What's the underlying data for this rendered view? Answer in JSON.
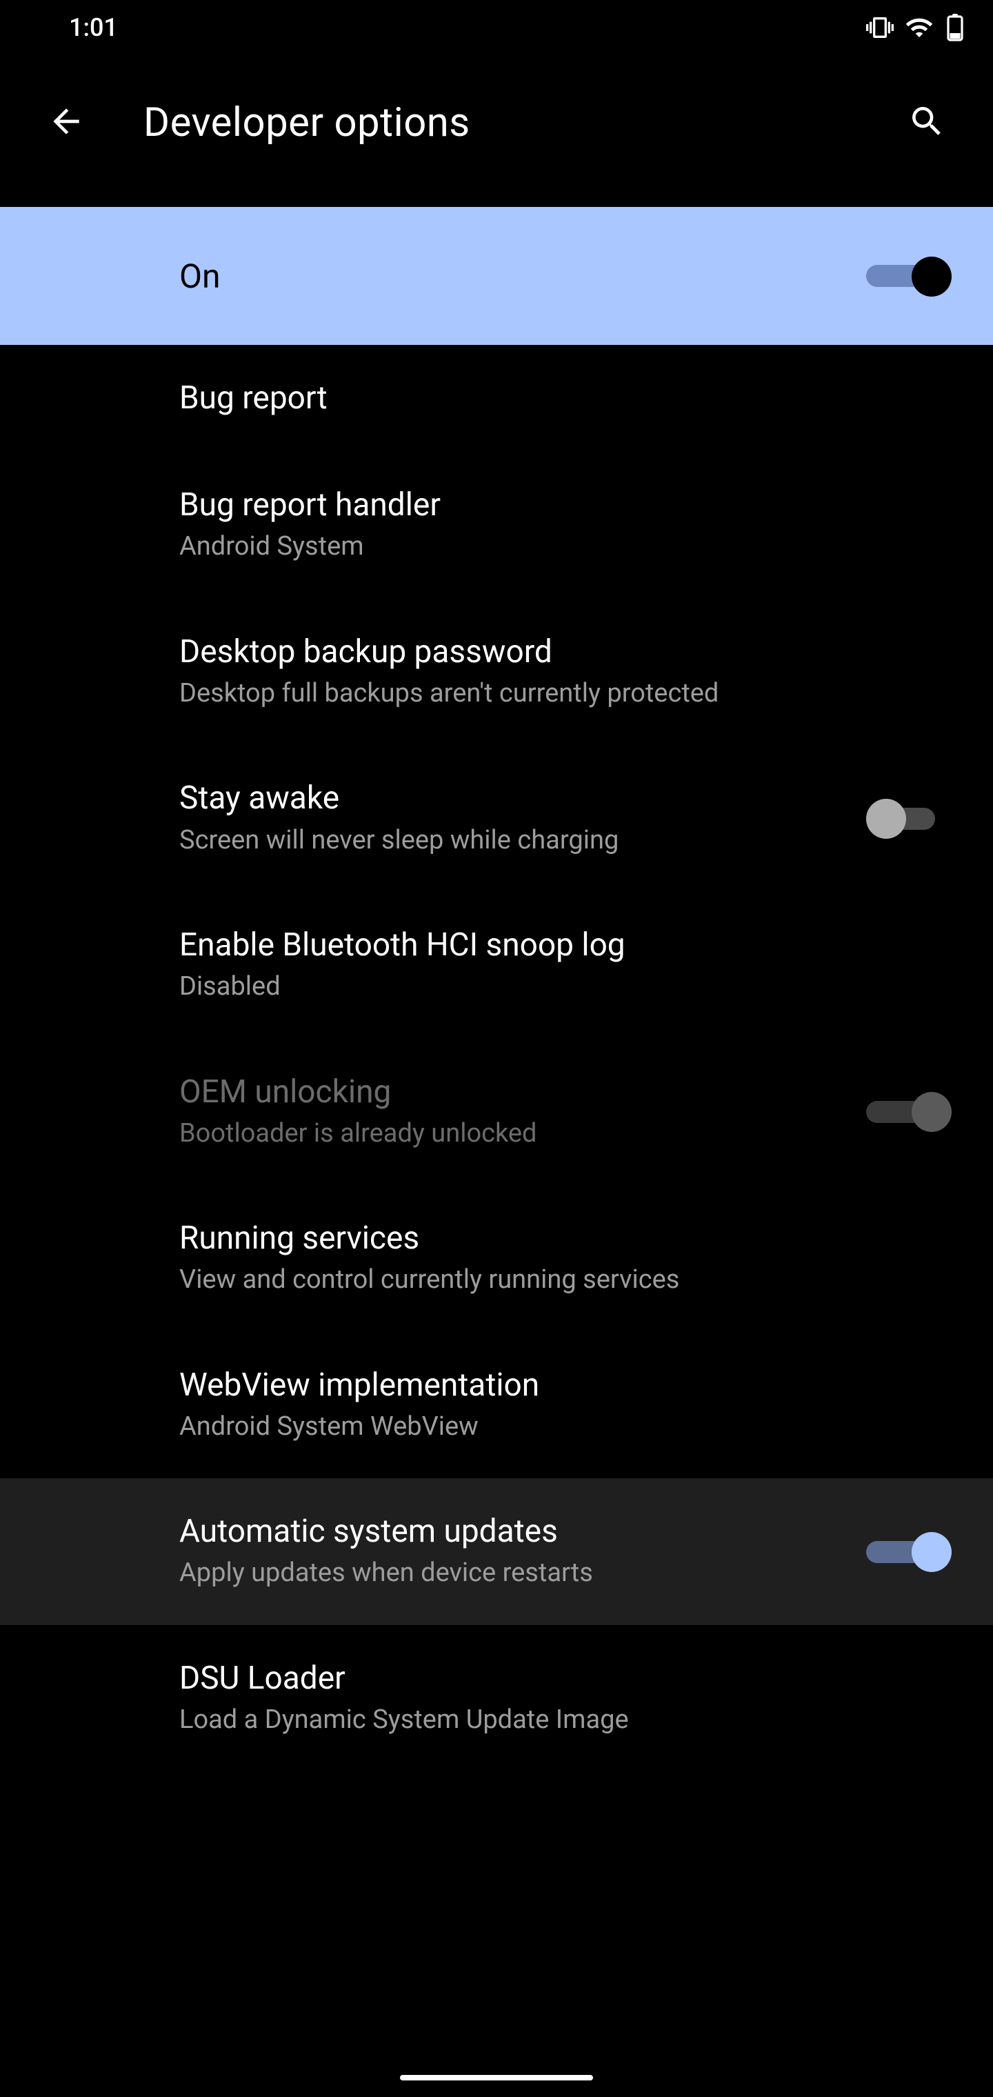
{
  "status": {
    "time": "1:01"
  },
  "header": {
    "title": "Developer options"
  },
  "master": {
    "label": "On",
    "on": true
  },
  "items": [
    {
      "title": "Bug report"
    },
    {
      "title": "Bug report handler",
      "sub": "Android System"
    },
    {
      "title": "Desktop backup password",
      "sub": "Desktop full backups aren't currently protected"
    },
    {
      "title": "Stay awake",
      "sub": "Screen will never sleep while charging",
      "toggle": "off"
    },
    {
      "title": "Enable Bluetooth HCI snoop log",
      "sub": "Disabled"
    },
    {
      "title": "OEM unlocking",
      "sub": "Bootloader is already unlocked",
      "toggle": "off-disabled",
      "disabled": true
    },
    {
      "title": "Running services",
      "sub": "View and control currently running services"
    },
    {
      "title": "WebView implementation",
      "sub": "Android System WebView"
    },
    {
      "title": "Automatic system updates",
      "sub": "Apply updates when device restarts",
      "toggle": "on-blue",
      "highlight": true
    },
    {
      "title": "DSU Loader",
      "sub": "Load a Dynamic System Update Image"
    }
  ]
}
